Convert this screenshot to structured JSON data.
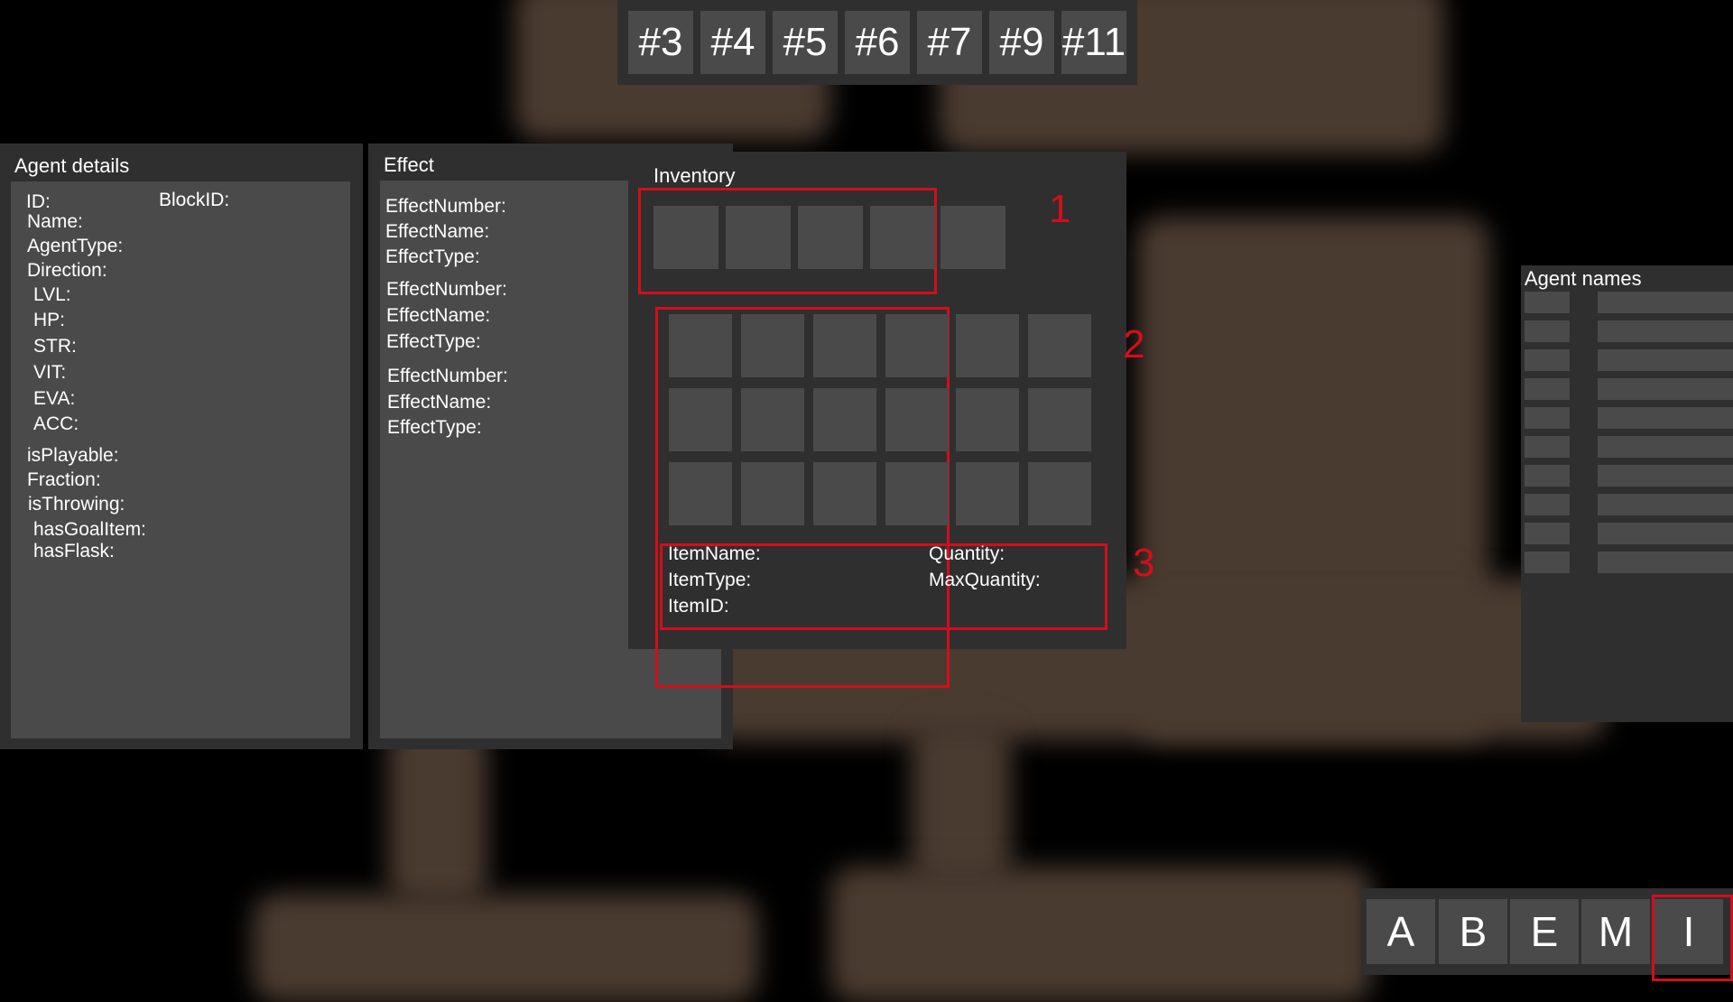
{
  "tabs": [
    "#3",
    "#4",
    "#5",
    "#6",
    "#7",
    "#9",
    "#11"
  ],
  "agent_details": {
    "title": "Agent details",
    "id_label": "ID:",
    "blockid_label": "BlockID:",
    "name_label": "Name:",
    "agenttype_label": "AgentType:",
    "direction_label": "Direction:",
    "lvl_label": "LVL:",
    "hp_label": "HP:",
    "str_label": "STR:",
    "vit_label": "VIT:",
    "eva_label": "EVA:",
    "acc_label": "ACC:",
    "isplayable_label": "isPlayable:",
    "fraction_label": "Fraction:",
    "isthrowing_label": "isThrowing:",
    "hasgoalitem_label": "hasGoalItem:",
    "hasflask_label": "hasFlask:"
  },
  "effect": {
    "title": "Effect",
    "groups": [
      {
        "number": "EffectNumber:",
        "name": "EffectName:",
        "type": "EffectType:"
      },
      {
        "number": "EffectNumber:",
        "name": "EffectName:",
        "type": "EffectType:"
      },
      {
        "number": "EffectNumber:",
        "name": "EffectName:",
        "type": "EffectType:"
      }
    ]
  },
  "inventory": {
    "title": "Inventory",
    "markers": [
      "1",
      "2",
      "3"
    ],
    "item_name_label": "ItemName:",
    "item_type_label": "ItemType:",
    "item_id_label": "ItemID:",
    "quantity_label": "Quantity:",
    "max_quantity_label": "MaxQuantity:"
  },
  "agent_names": {
    "title": "Agent names"
  },
  "bottom_buttons": [
    "A",
    "B",
    "E",
    "M",
    "I"
  ],
  "colors": {
    "panel": "#2f2f2f",
    "cell": "#4a4a4a",
    "highlight": "#d10f1b",
    "map_floor": "#4a3b30"
  }
}
